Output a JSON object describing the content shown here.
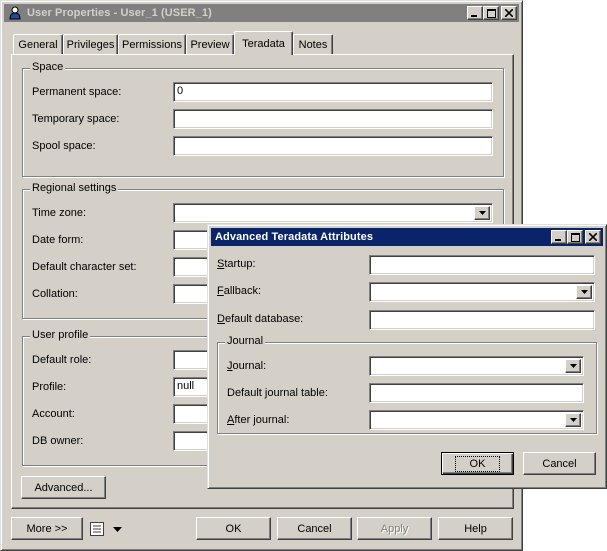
{
  "main_window": {
    "title": "User Properties - User_1 (USER_1)",
    "tabs": [
      {
        "label": "General"
      },
      {
        "label": "Privileges"
      },
      {
        "label": "Permissions"
      },
      {
        "label": "Preview"
      },
      {
        "label": "Teradata"
      },
      {
        "label": "Notes"
      }
    ],
    "selected_tab": "Teradata",
    "space": {
      "legend": "Space",
      "permanent_label": "Permanent space:",
      "permanent_value": "0",
      "temporary_label": "Temporary space:",
      "temporary_value": "",
      "spool_label": "Spool space:",
      "spool_value": ""
    },
    "regional": {
      "legend": "Regional settings",
      "timezone_label": "Time zone:",
      "timezone_value": "",
      "dateform_label": "Date form:",
      "charset_label": "Default character set:",
      "collation_label": "Collation:"
    },
    "user_profile": {
      "legend": "User profile",
      "default_role_label": "Default role:",
      "profile_label": "Profile:",
      "profile_value": "null",
      "account_label": "Account:",
      "db_owner_label": "DB owner:"
    },
    "advanced_button": "Advanced...",
    "footer": {
      "more": "More >>",
      "ok": "OK",
      "cancel": "Cancel",
      "apply": "Apply",
      "help": "Help"
    }
  },
  "dialog": {
    "title": "Advanced Teradata Attributes",
    "startup_label": "Startup:",
    "startup_mnemonic": "S",
    "startup_rest": "tartup:",
    "startup_value": "",
    "fallback_mnemonic": "F",
    "fallback_rest": "allback:",
    "fallback_value": "",
    "default_db_mnemonic": "D",
    "default_db_rest": "efault database:",
    "default_db_value": "",
    "journal": {
      "legend": "Journal",
      "journal_mnemonic": "J",
      "journal_rest": "ournal:",
      "journal_value": "",
      "default_table_pre": "Default ",
      "default_table_mnemonic": "j",
      "default_table_rest": "ournal table:",
      "default_table_value": "",
      "after_mnemonic": "A",
      "after_rest": "fter journal:",
      "after_value": ""
    },
    "ok": "OK",
    "cancel": "Cancel"
  },
  "icons": {
    "app": "user-icon",
    "list_menu": "list-icon"
  }
}
